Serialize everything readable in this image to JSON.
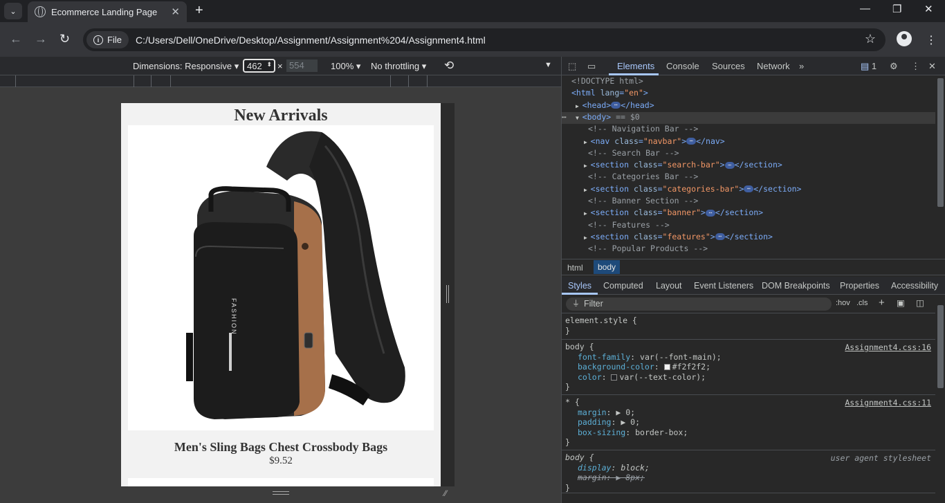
{
  "browser": {
    "tab_title": "Ecommerce Landing Page",
    "protocol_chip": "File",
    "url": "C:/Users/Dell/OneDrive/Desktop/Assignment/Assignment%204/Assignment4.html"
  },
  "device_toolbar": {
    "dimensions": "Dimensions: Responsive",
    "width": "462",
    "times": "×",
    "height": "554",
    "zoom": "100%",
    "throttling": "No throttling"
  },
  "page": {
    "heading": "New Arrivals",
    "product_name": "Men's Sling Bags Chest Crossbody Bags",
    "product_price": "$9.52",
    "bag_brand_text": "FASHION"
  },
  "devtools": {
    "tabs": [
      "Elements",
      "Console",
      "Sources",
      "Network"
    ],
    "more_tabs": "»",
    "issues_count": "1",
    "dom_lines": [
      {
        "comment": "<!DOCTYPE html>"
      },
      {
        "open": "<html",
        "attr": "lang",
        "val": "\"en\"",
        "close": ">"
      },
      {
        "open": "<head>",
        "ellipsis": true,
        "close": "</head>"
      },
      {
        "open": "<body>",
        "suffix": " == $0"
      },
      {
        "comment": "<!-- Navigation Bar -->"
      },
      {
        "open": "<nav",
        "attr": "class",
        "val": "\"navbar\"",
        "close": ">",
        "ellipsis": true,
        "end": "</nav>"
      },
      {
        "comment": "<!-- Search Bar -->"
      },
      {
        "open": "<section",
        "attr": "class",
        "val": "\"search-bar\"",
        "close": ">",
        "ellipsis": true,
        "end": "</section>"
      },
      {
        "comment": "<!-- Categories Bar -->"
      },
      {
        "open": "<section",
        "attr": "class",
        "val": "\"categories-bar\"",
        "close": ">",
        "ellipsis": true,
        "end": "</section>"
      },
      {
        "comment": "<!-- Banner Section -->"
      },
      {
        "open": "<section",
        "attr": "class",
        "val": "\"banner\"",
        "close": ">",
        "ellipsis": true,
        "end": "</section>"
      },
      {
        "comment": "<!-- Features -->"
      },
      {
        "open": "<section",
        "attr": "class",
        "val": "\"features\"",
        "close": ">",
        "ellipsis": true,
        "end": "</section>"
      },
      {
        "comment": "<!-- Popular Products -->"
      }
    ],
    "breadcrumbs": [
      "html",
      "body"
    ],
    "sub_tabs": [
      "Styles",
      "Computed",
      "Layout",
      "Event Listeners",
      "DOM Breakpoints",
      "Properties",
      "Accessibility"
    ],
    "filter_placeholder": "Filter",
    "hov": ":hov",
    "cls": ".cls",
    "styles": {
      "element_style": "element.style {",
      "close_brace": "}",
      "body_selector": "body {",
      "body_source": "Assignment4.css:16",
      "body_props": [
        {
          "prop": "font-family",
          "value": "var(--font-main);"
        },
        {
          "prop": "background-color",
          "value": "#f2f2f2;",
          "swatch": "#f2f2f2"
        },
        {
          "prop": "color",
          "value": "var(--text-color);",
          "swatch": "#202124"
        }
      ],
      "star_selector": "* {",
      "star_source": "Assignment4.css:11",
      "star_props": [
        {
          "prop": "margin",
          "value": "▶ 0;"
        },
        {
          "prop": "padding",
          "value": "▶ 0;"
        },
        {
          "prop": "box-sizing",
          "value": "border-box;"
        }
      ],
      "ua_selector": "body {",
      "ua_source": "user agent stylesheet",
      "ua_props": [
        {
          "prop": "display",
          "value": "block;"
        },
        {
          "prop": "margin",
          "value": "▶ 8px;",
          "struck": true
        }
      ]
    }
  }
}
